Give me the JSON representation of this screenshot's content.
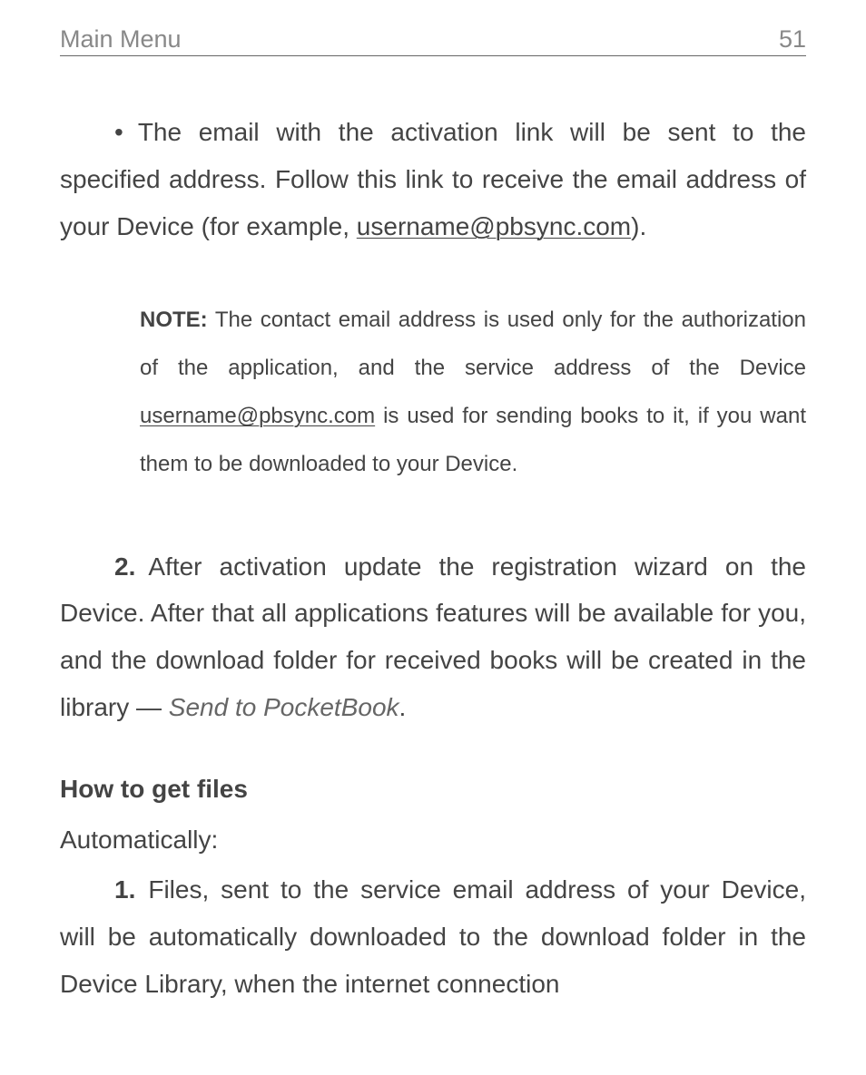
{
  "header": {
    "title": "Main Menu",
    "page": "51"
  },
  "bullet1": {
    "text1": "The email with the activation link will be sent to the specified address. Follow this link to receive the email address of your Device (for example, ",
    "link": "username@pbsync.com",
    "text2": ")."
  },
  "note": {
    "label": "NOTE:",
    "text1": " The contact email address is used only for the authorization of the application, and the service address of the Device ",
    "link": "username@pbsync.com",
    "text2": " is used for sending books to it, if you want them to be downloaded to your Device."
  },
  "step2": {
    "number": "2.",
    "text1": "After activation update the registration wizard on the Device. After that all applications features will be available for you, and the download folder for received books will be created in the library — ",
    "italic": "Send to PocketBook",
    "text2": "."
  },
  "subheading": "How to get files",
  "mode": "Automatically:",
  "step1b": {
    "number": "1.",
    "text": "Files, sent to the service email address of your Device, will be automatically downloaded to the download folder in the Device Library, when the internet connection"
  }
}
